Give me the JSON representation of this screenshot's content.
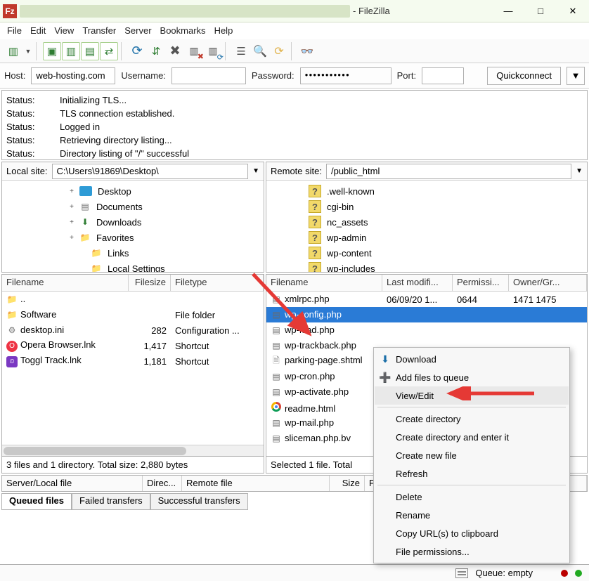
{
  "title": "- FileZilla",
  "menu": [
    "File",
    "Edit",
    "View",
    "Transfer",
    "Server",
    "Bookmarks",
    "Help"
  ],
  "connect": {
    "host_label": "Host:",
    "host": "web-hosting.com",
    "user_label": "Username:",
    "user": "",
    "pass_label": "Password:",
    "pass": "●●●●●●●●●●●",
    "port_label": "Port:",
    "port": "",
    "quick": "Quickconnect"
  },
  "log": [
    {
      "k": "Status:",
      "v": "Initializing TLS..."
    },
    {
      "k": "Status:",
      "v": "TLS connection established."
    },
    {
      "k": "Status:",
      "v": "Logged in"
    },
    {
      "k": "Status:",
      "v": "Retrieving directory listing..."
    },
    {
      "k": "Status:",
      "v": "Directory listing of \"/\" successful"
    }
  ],
  "local": {
    "label": "Local site:",
    "path": "C:\\Users\\91869\\Desktop\\",
    "tree": [
      {
        "indent": 90,
        "tw": "+",
        "icon": "desktop",
        "label": "Desktop"
      },
      {
        "indent": 90,
        "tw": "+",
        "icon": "docs",
        "label": "Documents"
      },
      {
        "indent": 90,
        "tw": "+",
        "icon": "down",
        "label": "Downloads"
      },
      {
        "indent": 90,
        "tw": "+",
        "icon": "folder",
        "label": "Favorites"
      },
      {
        "indent": 106,
        "tw": "",
        "icon": "folder",
        "label": "Links"
      },
      {
        "indent": 106,
        "tw": "",
        "icon": "folder",
        "label": "Local Settings"
      }
    ]
  },
  "remote": {
    "label": "Remote site:",
    "path": "/public_html",
    "tree": [
      {
        "indent": 40,
        "icon": "q",
        "label": ".well-known"
      },
      {
        "indent": 40,
        "icon": "q",
        "label": "cgi-bin"
      },
      {
        "indent": 40,
        "icon": "q",
        "label": "nc_assets"
      },
      {
        "indent": 40,
        "icon": "q",
        "label": "wp-admin"
      },
      {
        "indent": 40,
        "icon": "q",
        "label": "wp-content"
      },
      {
        "indent": 40,
        "icon": "q",
        "label": "wp-includes"
      }
    ]
  },
  "local_list": {
    "cols": [
      "Filename",
      "Filesize",
      "Filetype"
    ],
    "rows": [
      {
        "icon": "up",
        "name": "..",
        "size": "",
        "type": ""
      },
      {
        "icon": "folder",
        "name": "Software",
        "size": "",
        "type": "File folder"
      },
      {
        "icon": "ini",
        "name": "desktop.ini",
        "size": "282",
        "type": "Configuration ..."
      },
      {
        "icon": "opera",
        "name": "Opera Browser.lnk",
        "size": "1,417",
        "type": "Shortcut"
      },
      {
        "icon": "toggl",
        "name": "Toggl Track.lnk",
        "size": "1,181",
        "type": "Shortcut"
      }
    ],
    "status": "3 files and 1 directory. Total size: 2,880 bytes"
  },
  "remote_list": {
    "cols": [
      "Filename",
      "Last modifi...",
      "Permissi...",
      "Owner/Gr..."
    ],
    "rows": [
      {
        "icon": "php",
        "name": "xmlrpc.php",
        "mod": "06/09/20 1...",
        "perm": "0644",
        "own": "1471 1475"
      },
      {
        "icon": "php",
        "name": "wp-config.php",
        "selected": true
      },
      {
        "icon": "php",
        "name": "wp-load.php"
      },
      {
        "icon": "php",
        "name": "wp-trackback.php"
      },
      {
        "icon": "txt",
        "name": "parking-page.shtml"
      },
      {
        "icon": "php",
        "name": "wp-cron.php"
      },
      {
        "icon": "php",
        "name": "wp-activate.php"
      },
      {
        "icon": "chrome",
        "name": "readme.html"
      },
      {
        "icon": "php",
        "name": "wp-mail.php"
      },
      {
        "icon": "php",
        "name": "sliceman.php.bv"
      }
    ],
    "status": "Selected 1 file. Total"
  },
  "context_menu": {
    "items": [
      {
        "icon": "down-blue",
        "label": "Download"
      },
      {
        "icon": "plus-green",
        "label": "Add files to queue"
      },
      {
        "label": "View/Edit",
        "hover": true
      },
      {
        "sep": true
      },
      {
        "label": "Create directory"
      },
      {
        "label": "Create directory and enter it"
      },
      {
        "label": "Create new file"
      },
      {
        "label": "Refresh"
      },
      {
        "sep": true
      },
      {
        "label": "Delete"
      },
      {
        "label": "Rename"
      },
      {
        "label": "Copy URL(s) to clipboard"
      },
      {
        "label": "File permissions..."
      }
    ]
  },
  "queue_head": [
    "Server/Local file",
    "Direc...",
    "Remote file",
    "Size",
    "Priority"
  ],
  "queue_tabs": [
    "Queued files",
    "Failed transfers",
    "Successful transfers"
  ],
  "bottombar": {
    "queue": "Queue: empty"
  }
}
